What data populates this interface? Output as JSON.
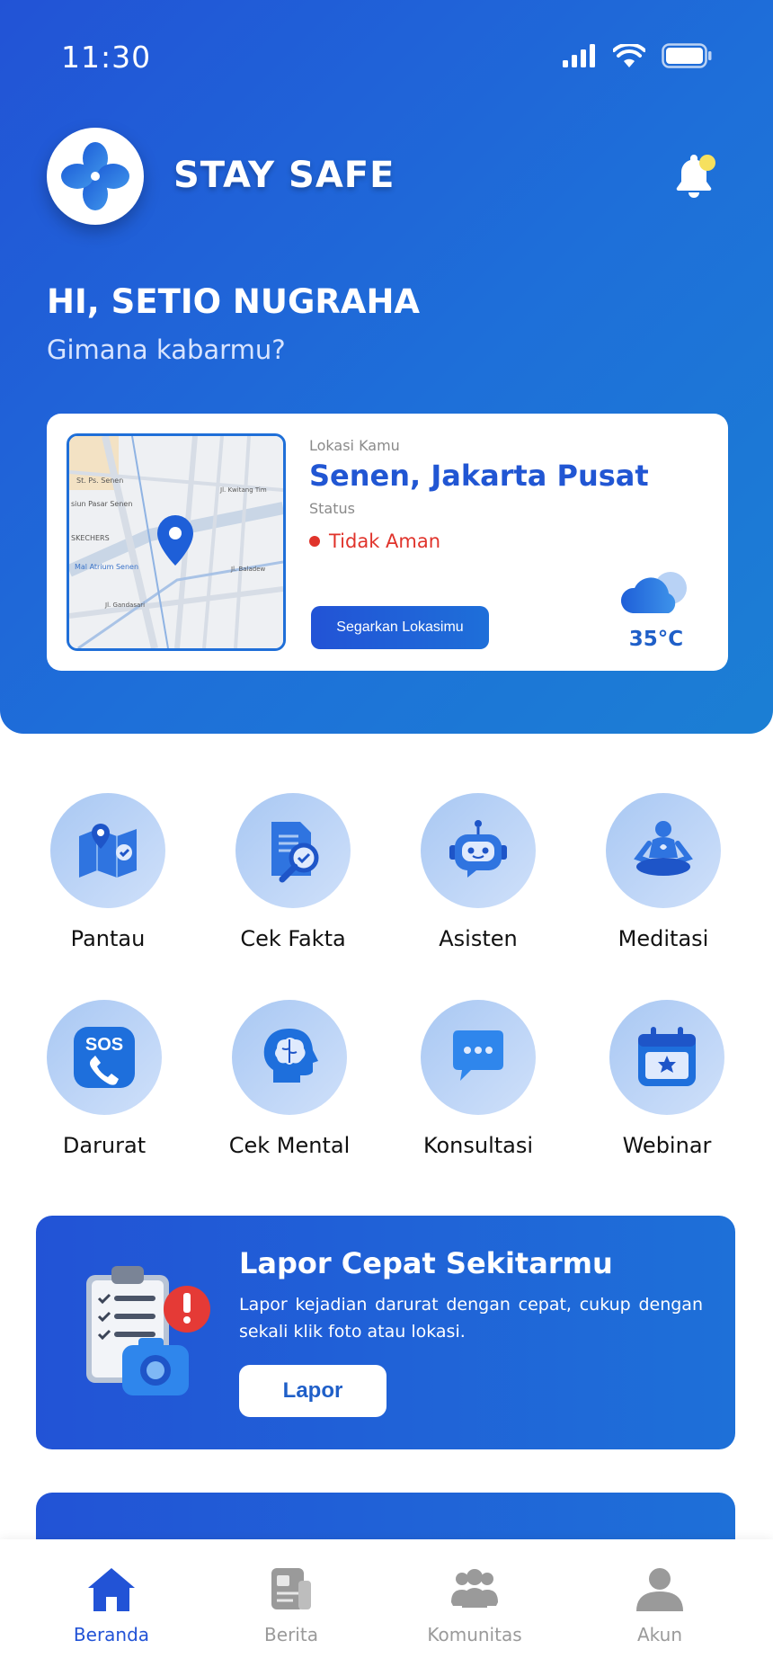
{
  "status_bar": {
    "time": "11:30"
  },
  "header": {
    "app_title": "STAY SAFE"
  },
  "greeting": {
    "name": "HI, SETIO NUGRAHA",
    "subtitle": "Gimana kabarmu?"
  },
  "location_card": {
    "location_label": "Lokasi Kamu",
    "location_name": "Senen, Jakarta Pusat",
    "status_label": "Status",
    "status_value": "Tidak Aman",
    "refresh_button": "Segarkan Lokasimu",
    "temperature": "35°C",
    "map_labels": [
      "St. Ps. Senen",
      "siun Pasar Senen",
      "SKECHERS",
      "Mal Atrium Senen",
      "Jl. Kwitang Tim",
      "Jl. Baladew",
      "Jl. Gandasari"
    ]
  },
  "menu": [
    {
      "label": "Pantau",
      "icon": "map-check-icon"
    },
    {
      "label": "Cek Fakta",
      "icon": "document-search-icon"
    },
    {
      "label": "Asisten",
      "icon": "robot-icon"
    },
    {
      "label": "Meditasi",
      "icon": "meditation-icon"
    },
    {
      "label": "Darurat",
      "icon": "sos-phone-icon"
    },
    {
      "label": "Cek Mental",
      "icon": "brain-head-icon"
    },
    {
      "label": "Konsultasi",
      "icon": "chat-bubble-icon"
    },
    {
      "label": "Webinar",
      "icon": "calendar-star-icon"
    }
  ],
  "report": {
    "title": "Lapor Cepat Sekitarmu",
    "description": "Lapor kejadian darurat dengan cepat, cukup dengan sekali klik foto atau lokasi.",
    "button": "Lapor"
  },
  "bottom_nav": [
    {
      "label": "Beranda",
      "active": true
    },
    {
      "label": "Berita",
      "active": false
    },
    {
      "label": "Komunitas",
      "active": false
    },
    {
      "label": "Akun",
      "active": false
    }
  ],
  "colors": {
    "primary": "#2253d6",
    "danger": "#e0332b",
    "inactive": "#9a9a9a"
  }
}
